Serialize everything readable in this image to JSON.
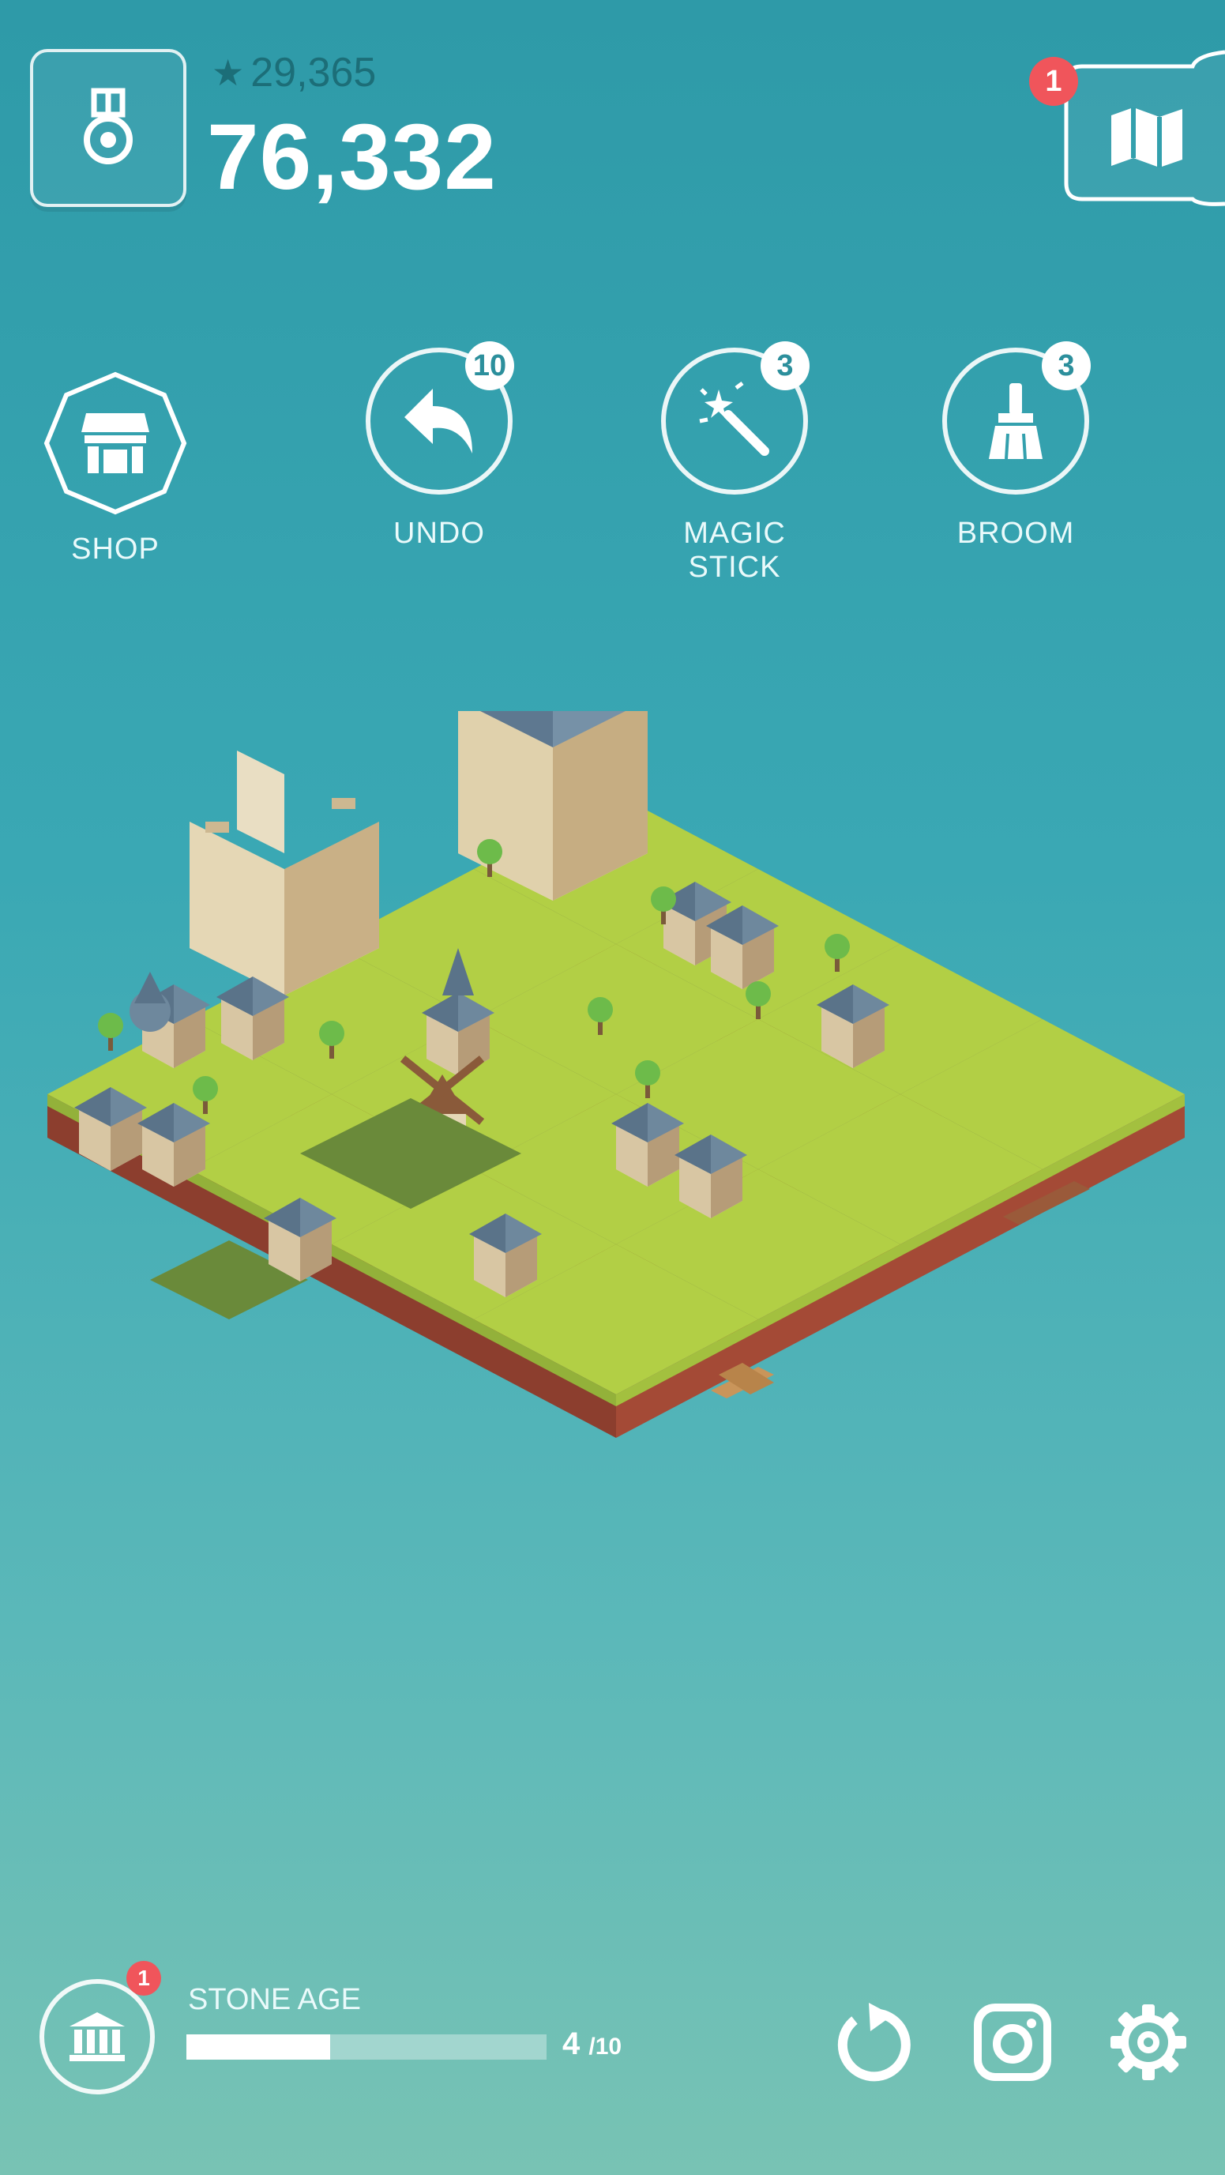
{
  "hud": {
    "best_score": "29,365",
    "score": "76,332",
    "map_notification": "1"
  },
  "tools": [
    {
      "label": "SHOP",
      "icon": "shop-icon",
      "count": ""
    },
    {
      "label": "UNDO",
      "icon": "undo-icon",
      "count": "10"
    },
    {
      "label": "MAGIC STICK",
      "icon": "magic-stick-icon",
      "count": "3"
    },
    {
      "label": "BROOM",
      "icon": "broom-icon",
      "count": "3"
    }
  ],
  "age": {
    "label": "STONE AGE",
    "notification": "1",
    "progress_current": "4",
    "progress_total": "/10",
    "progress_fraction": 0.4
  },
  "colors": {
    "background_top": "#2e9aa8",
    "background_bottom": "#78c3b4",
    "badge_red": "#f0555b",
    "grass": "#a9c93f",
    "soil": "#8f3f2f"
  },
  "icons": [
    "medal-icon",
    "map-icon",
    "star-icon",
    "museum-icon",
    "restart-icon",
    "instagram-icon",
    "settings-icon"
  ]
}
